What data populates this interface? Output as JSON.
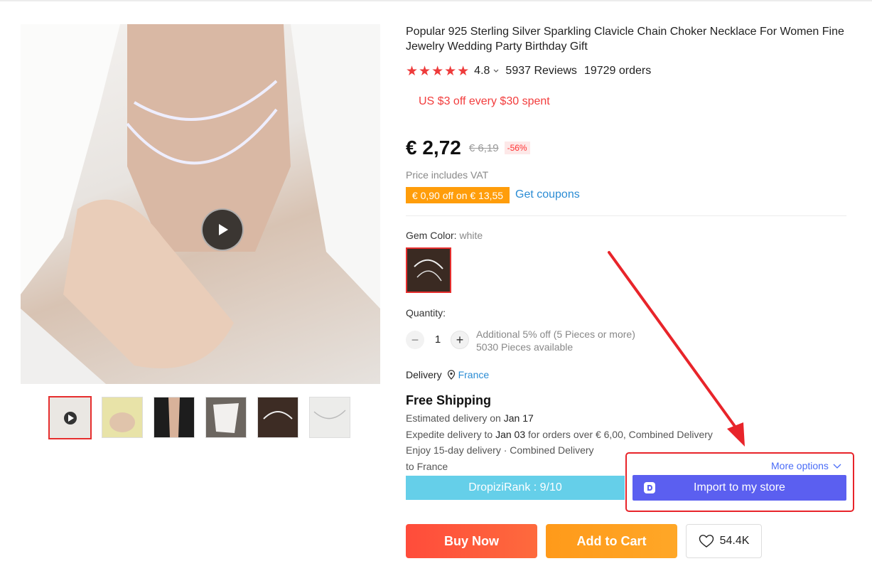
{
  "product": {
    "title": "Popular 925 Sterling Silver Sparkling Clavicle Chain Choker Necklace For Women Fine Jewelry Wedding Party Birthday Gift",
    "rating": "4.8",
    "reviews": "5937 Reviews",
    "orders": "19729 orders",
    "stars_filled": 5
  },
  "promo": {
    "text": "US $3 off every $30 spent"
  },
  "price": {
    "current": "€ 2,72",
    "original": "€ 6,19",
    "discount": "-56%",
    "vat_note": "Price includes VAT"
  },
  "coupon": {
    "badge": "€ 0,90 off on € 13,55",
    "link": "Get coupons"
  },
  "gem": {
    "label": "Gem Color:",
    "value": "white"
  },
  "quantity": {
    "label": "Quantity:",
    "value": "1",
    "minus": "−",
    "plus": "+",
    "note1": "Additional 5% off (5 Pieces or more)",
    "note2": "5030 Pieces available"
  },
  "delivery": {
    "label": "Delivery",
    "country": "France",
    "free_shipping": "Free Shipping",
    "line1_a": "Estimated delivery on ",
    "line1_b": "Jan 17",
    "line2_a": "Expedite delivery to ",
    "line2_b": "Jan 03",
    "line2_c": " for orders over € 6,00, Combined Delivery",
    "line3": "Enjoy 15-day delivery · Combined Delivery",
    "line4": "to France"
  },
  "dropizi": {
    "rank": "DropiziRank : 9/10",
    "more_options": "More options",
    "import_label": "Import to my store"
  },
  "actions": {
    "buy_now": "Buy Now",
    "add_to_cart": "Add to Cart",
    "wishlist_count": "54.4K"
  },
  "colors": {
    "accent_red": "#e62e2e",
    "coupon_orange": "#ff9d0a",
    "link_blue": "#2b8cd4",
    "dropizi_purple": "#5b5ff0",
    "rank_cyan": "#65cfe9"
  },
  "icons": [
    "play-icon",
    "star-icon",
    "chevron-down-icon",
    "location-pin-icon",
    "heart-icon",
    "dropizi-logo-icon"
  ]
}
